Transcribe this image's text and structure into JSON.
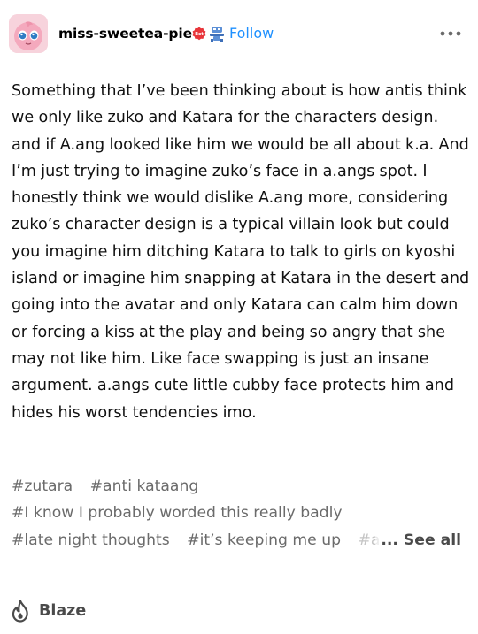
{
  "header": {
    "username": "miss-sweetea-pie",
    "follow_label": "Follow",
    "badge1_text": "Bet",
    "accent": "#1e90ff"
  },
  "post": {
    "body": "Something that I’ve been thinking about is how antis think we only like zuko and Katara for the characters design. and if A.ang looked like him we would be all about k.a. And I’m just trying to imagine zuko’s face in a.angs spot. I honestly think we would dislike A.ang more, considering zuko’s character design is a typical villain look but could you imagine him ditching Katara to talk to girls on kyoshi island or imagine him snapping at Katara in the desert and going into the avatar and only Katara can calm him down or forcing a kiss at the play and being so angry that she may not like him. Like face swapping is just an insane argument. a.angs cute little cubby face protects him and hides his worst tendencies imo.",
    "tags": [
      "#zutara",
      "#anti kataang",
      "#I know I probably worded this really badly",
      "#late night thoughts",
      "#it’s keeping me up",
      "#a"
    ],
    "see_all_label": "... See all"
  },
  "footer": {
    "blaze_label": "Blaze"
  },
  "icons": {
    "avatar": "jigglypuff-avatar",
    "badge1": "red-bet-badge",
    "badge2": "blue-robot-badge",
    "more": "more-options-icon",
    "blaze": "flame-icon"
  }
}
